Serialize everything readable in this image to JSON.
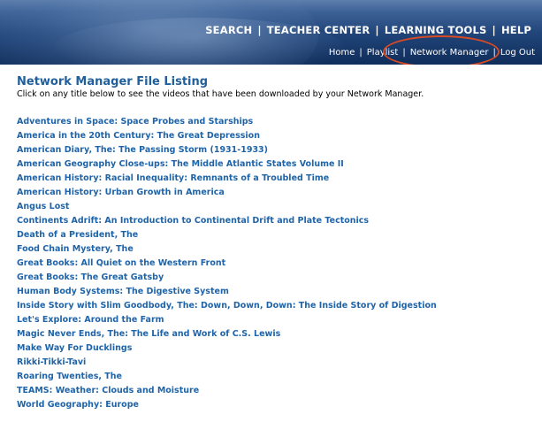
{
  "header": {
    "top_nav": [
      "SEARCH",
      "TEACHER CENTER",
      "LEARNING TOOLS",
      "HELP"
    ],
    "sub_nav": [
      "Home",
      "Playlist",
      "Network Manager",
      "Log Out"
    ],
    "separator": "|"
  },
  "main": {
    "title": "Network Manager File Listing",
    "subtitle": "Click on any title below to see the videos that have been downloaded by your Network Manager.",
    "files": [
      "Adventures in Space: Space Probes and Starships",
      "America in the 20th Century: The Great Depression",
      "American Diary, The: The Passing Storm (1931-1933)",
      "American Geography Close-ups: The Middle Atlantic States Volume II",
      "American History: Racial Inequality: Remnants of a Troubled Time",
      "American History: Urban Growth in America",
      "Angus Lost",
      "Continents Adrift: An Introduction to Continental Drift and Plate Tectonics",
      "Death of a President, The",
      "Food Chain Mystery, The",
      "Great Books: All Quiet on the Western Front",
      "Great Books: The Great Gatsby",
      "Human Body Systems: The Digestive System",
      "Inside Story with Slim Goodbody, The: Down, Down, Down: The Inside Story of Digestion",
      "Let's Explore: Around the Farm",
      "Magic Never Ends, The: The Life and Work of C.S. Lewis",
      "Make Way For Ducklings",
      "Rikki-Tikki-Tavi",
      "Roaring Twenties, The",
      "TEAMS: Weather: Clouds and Moisture",
      "World Geography: Europe"
    ]
  },
  "colors": {
    "header_dark": "#102d5a",
    "header_mid": "#22467b",
    "title_blue": "#1f5f9c",
    "link_blue": "#1f64a8",
    "highlight_red": "#d94a24"
  }
}
